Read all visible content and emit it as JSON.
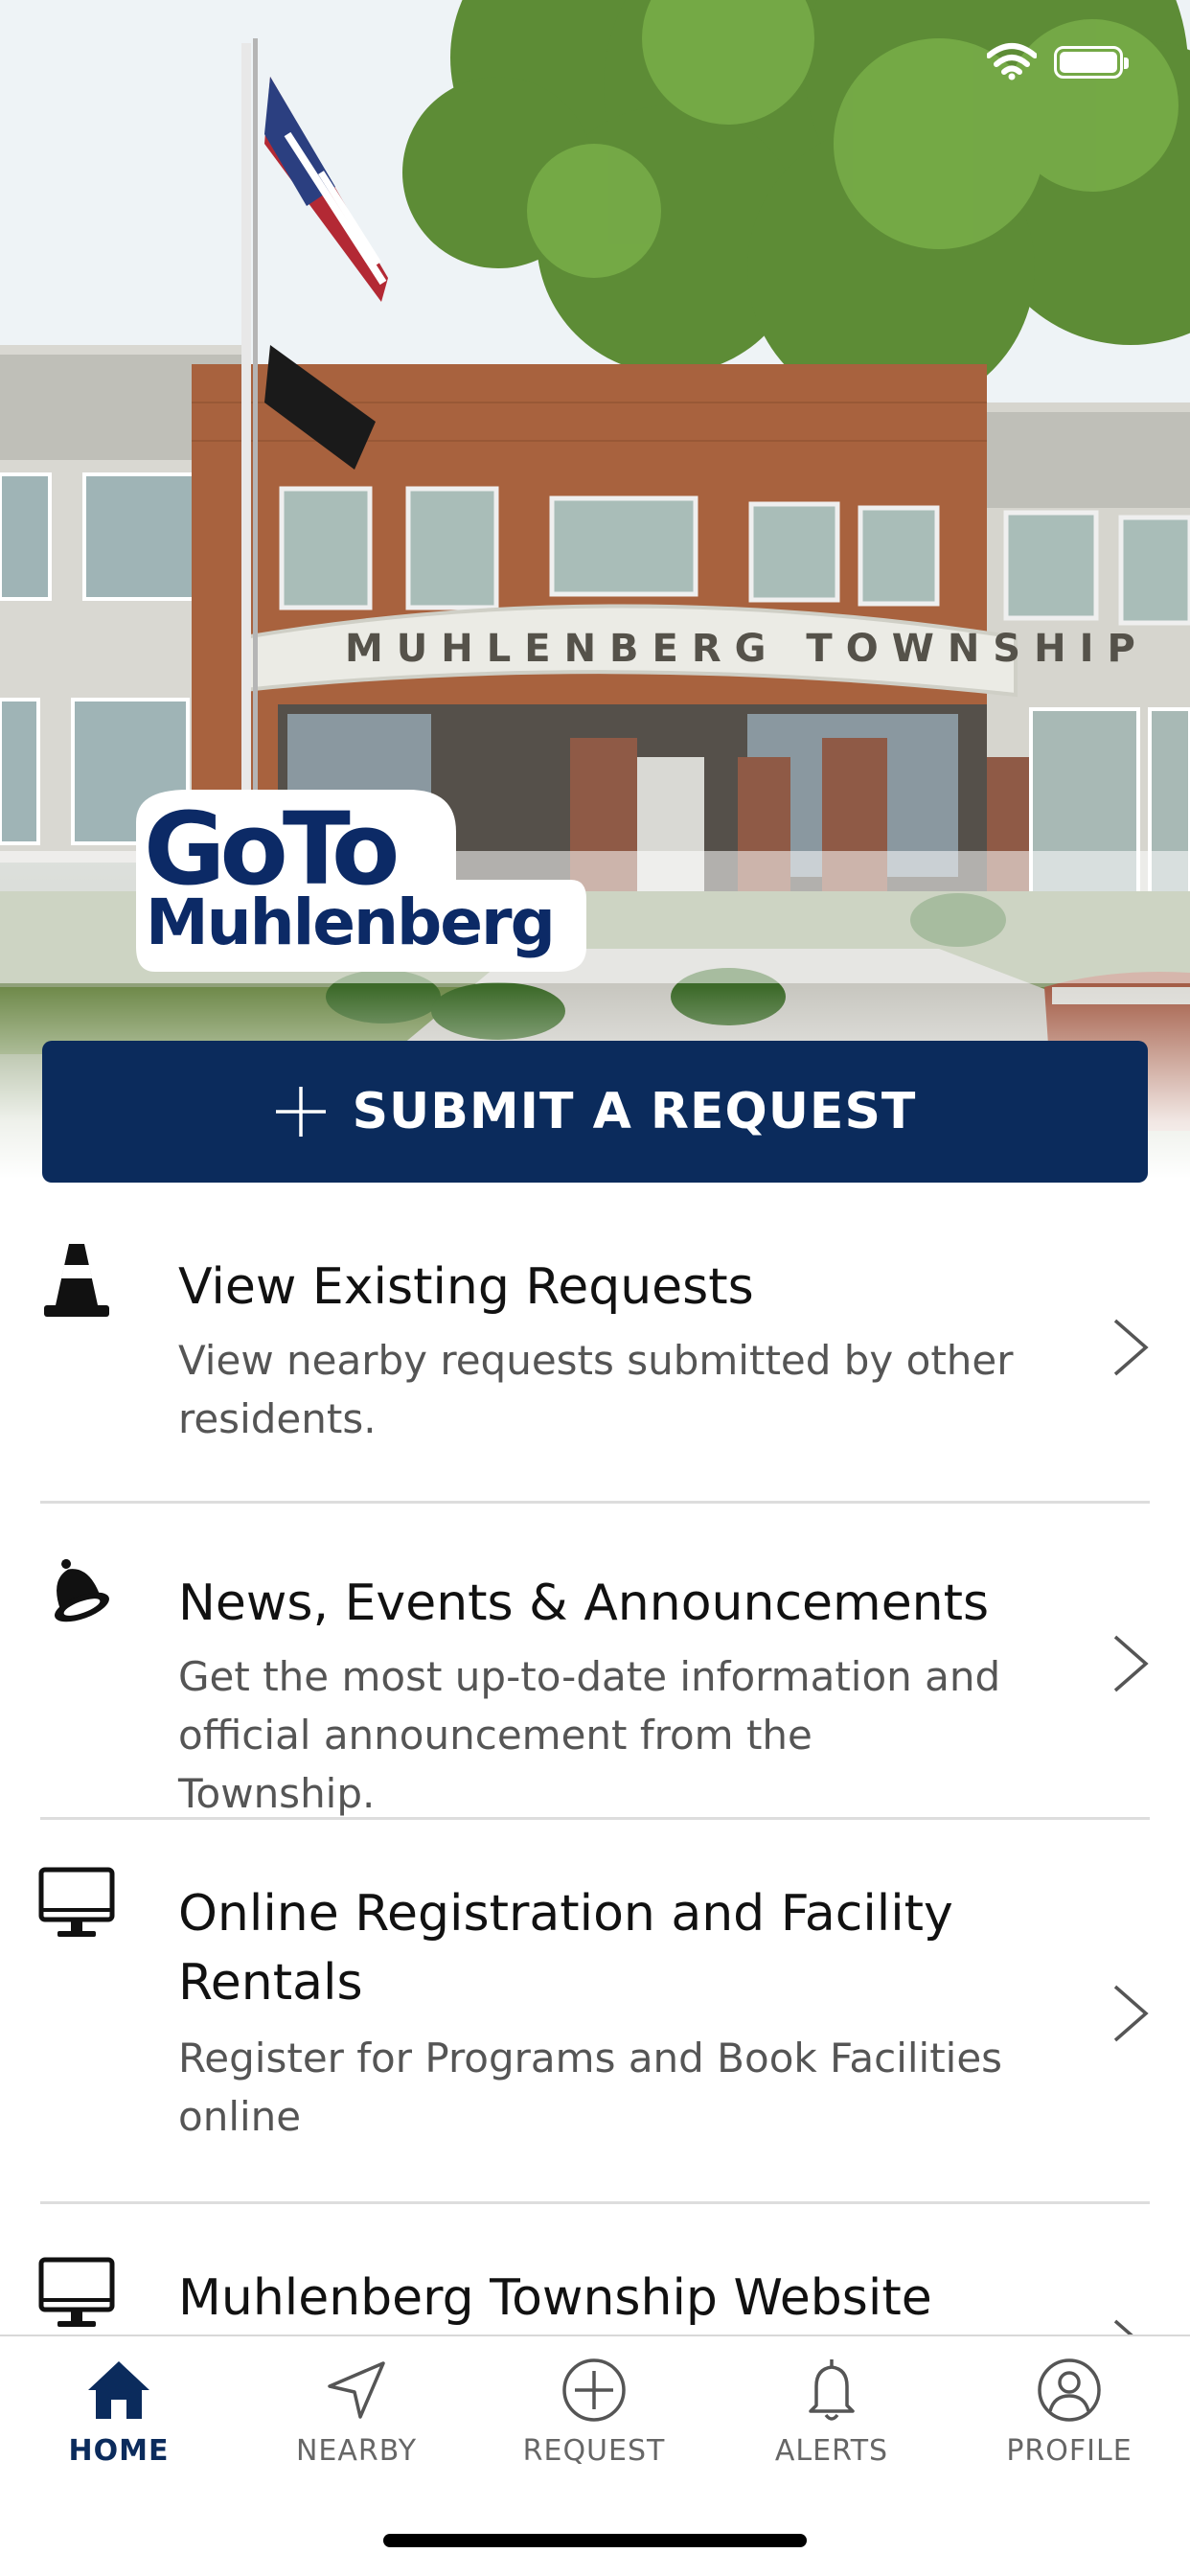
{
  "hero": {
    "building_sign": "MUHLENBERG TOWNSHIP"
  },
  "logo": {
    "line1": "GoTo",
    "line2": "Muhlenberg"
  },
  "submit": {
    "label": "SUBMIT A REQUEST"
  },
  "menu": {
    "items": [
      {
        "icon": "traffic-cone-icon",
        "title": "View Existing Requests",
        "description": "View nearby requests submitted by other residents."
      },
      {
        "icon": "bell-icon",
        "title": "News, Events & Announcements",
        "description": "Get the most up-to-date information and official announcement from the Township."
      },
      {
        "icon": "computer-monitor-icon",
        "title": "Online Registration and Facility Rentals",
        "description": "Register for Programs and Book Facilities online"
      },
      {
        "icon": "computer-monitor-icon",
        "title": "Muhlenberg Township Website",
        "description": ""
      }
    ]
  },
  "tabbar": {
    "tabs": [
      {
        "label": "HOME",
        "icon": "home-icon",
        "active": true
      },
      {
        "label": "NEARBY",
        "icon": "location-arrow-icon",
        "active": false
      },
      {
        "label": "REQUEST",
        "icon": "plus-circle-icon",
        "active": false
      },
      {
        "label": "ALERTS",
        "icon": "bell-icon",
        "active": false
      },
      {
        "label": "PROFILE",
        "icon": "user-circle-icon",
        "active": false
      }
    ]
  },
  "colors": {
    "brand_navy": "#0b2b5c",
    "logo_navy": "#0c2a66",
    "tab_inactive": "#666666",
    "divider": "#dddddd"
  }
}
